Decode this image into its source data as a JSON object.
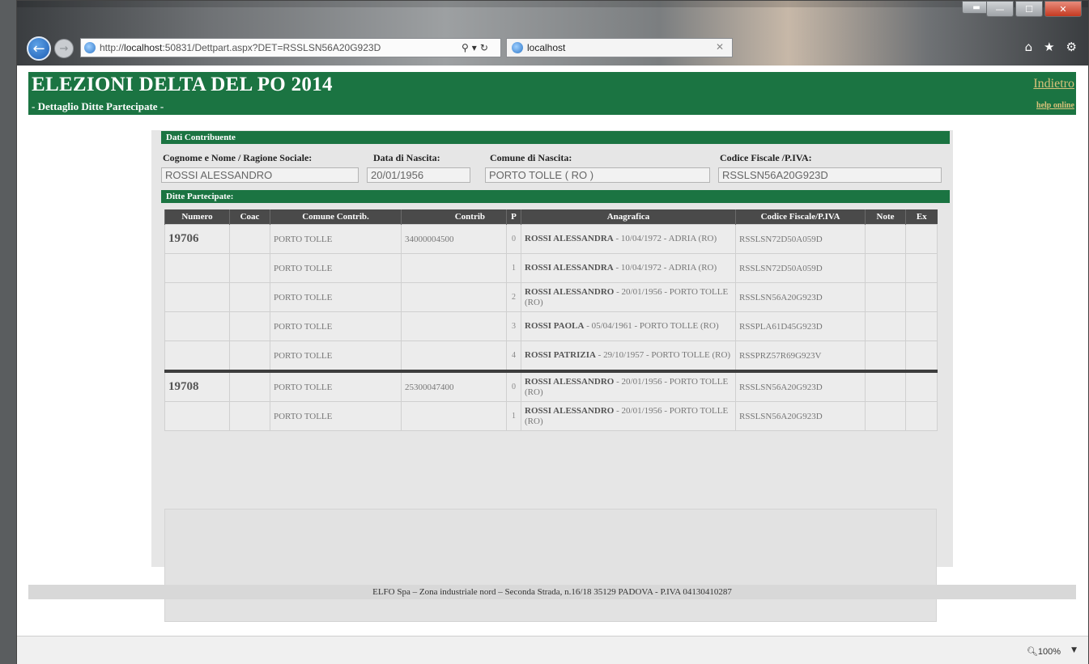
{
  "browser": {
    "url_prefix": "http://",
    "url_host": "localhost",
    "url_rest": ":50831/Dettpart.aspx?DET=RSSLSN56A20G923D",
    "tab_title": "localhost",
    "zoom": "100%"
  },
  "header": {
    "title": "ELEZIONI DELTA DEL PO 2014",
    "subtitle": "- Dettaglio Ditte Partecipate -",
    "back_link": "Indietro",
    "help_link": "help online"
  },
  "contribuente": {
    "section_title": "Dati Contribuente",
    "fields": [
      {
        "label": "Cognome e Nome / Ragione Sociale:",
        "value": "ROSSI ALESSANDRO"
      },
      {
        "label": "Data di Nascita:",
        "value": "20/01/1956"
      },
      {
        "label": "Comune di Nascita:",
        "value": "PORTO TOLLE ( RO )"
      },
      {
        "label": "Codice Fiscale /P.IVA:",
        "value": "RSSLSN56A20G923D"
      }
    ]
  },
  "ditte": {
    "section_title": "Ditte Partecipate:",
    "columns": [
      "Numero",
      "Coac",
      "Comune Contrib.",
      "Contrib",
      "P",
      "Anagrafica",
      "Codice Fiscale/P.IVA",
      "Note",
      "Ex"
    ],
    "rows": [
      {
        "numero": "19706",
        "coac": "",
        "comune": "PORTO TOLLE",
        "contrib": "34000004500",
        "p": "0",
        "nome": "ROSSI ALESSANDRA",
        "dettaglio": " - 10/04/1972 - ADRIA (RO)",
        "cf": "RSSLSN72D50A059D",
        "note": "",
        "ex": ""
      },
      {
        "numero": "",
        "coac": "",
        "comune": "PORTO TOLLE",
        "contrib": "",
        "p": "1",
        "nome": "ROSSI ALESSANDRA",
        "dettaglio": " - 10/04/1972 - ADRIA (RO)",
        "cf": "RSSLSN72D50A059D",
        "note": "",
        "ex": ""
      },
      {
        "numero": "",
        "coac": "",
        "comune": "PORTO TOLLE",
        "contrib": "",
        "p": "2",
        "nome": "ROSSI ALESSANDRO",
        "dettaglio": " - 20/01/1956 - PORTO TOLLE (RO)",
        "cf": "RSSLSN56A20G923D",
        "note": "",
        "ex": ""
      },
      {
        "numero": "",
        "coac": "",
        "comune": "PORTO TOLLE",
        "contrib": "",
        "p": "3",
        "nome": "ROSSI PAOLA",
        "dettaglio": " - 05/04/1961 - PORTO TOLLE (RO)",
        "cf": "RSSPLA61D45G923D",
        "note": "",
        "ex": ""
      },
      {
        "numero": "",
        "coac": "",
        "comune": "PORTO TOLLE",
        "contrib": "",
        "p": "4",
        "nome": "ROSSI PATRIZIA",
        "dettaglio": " - 29/10/1957 - PORTO TOLLE (RO)",
        "cf": "RSSPRZ57R69G923V",
        "note": "",
        "ex": ""
      },
      {
        "numero": "19708",
        "coac": "",
        "comune": "PORTO TOLLE",
        "contrib": "25300047400",
        "p": "0",
        "nome": "ROSSI ALESSANDRO",
        "dettaglio": " - 20/01/1956 - PORTO TOLLE (RO)",
        "cf": "RSSLSN56A20G923D",
        "note": "",
        "ex": ""
      },
      {
        "numero": "",
        "coac": "",
        "comune": "PORTO TOLLE",
        "contrib": "",
        "p": "1",
        "nome": "ROSSI ALESSANDRO",
        "dettaglio": " - 20/01/1956 - PORTO TOLLE (RO)",
        "cf": "RSSLSN56A20G923D",
        "note": "",
        "ex": ""
      }
    ]
  },
  "footer": {
    "text": "ELFO Spa – Zona industriale nord – Seconda Strada, n.16/18 35129 PADOVA - P.IVA 04130410287"
  }
}
